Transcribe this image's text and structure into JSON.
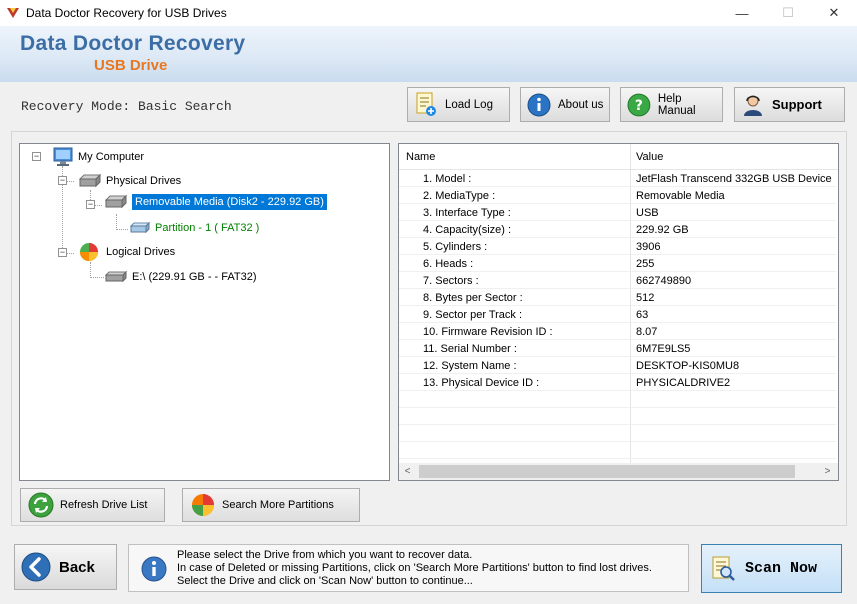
{
  "window": {
    "title": "Data Doctor Recovery for USB Drives",
    "minimize": "—",
    "maximize": "☐",
    "close": "✕"
  },
  "banner": {
    "title": "Data Doctor Recovery",
    "subtitle": "USB Drive"
  },
  "toolbar": {
    "mode_text": "Recovery Mode: Basic Search",
    "load_log": "Load Log",
    "about_us": "About us",
    "help_manual": "Help Manual",
    "support": "Support"
  },
  "tree": {
    "root": "My Computer",
    "physical_drives": "Physical Drives",
    "removable_media": "Removable Media (Disk2 - 229.92 GB)",
    "partition": "Partition - 1 ( FAT32 )",
    "logical_drives": "Logical Drives",
    "logical_e": "E:\\ (229.91 GB -  - FAT32)"
  },
  "props": {
    "col_name": "Name",
    "col_value": "Value",
    "rows": [
      {
        "name": "1. Model :",
        "value": "JetFlash Transcend 332GB USB Device"
      },
      {
        "name": "2. MediaType :",
        "value": "Removable Media"
      },
      {
        "name": "3. Interface Type :",
        "value": "USB"
      },
      {
        "name": "4. Capacity(size) :",
        "value": "229.92 GB"
      },
      {
        "name": "5. Cylinders :",
        "value": "3906"
      },
      {
        "name": "6. Heads :",
        "value": "255"
      },
      {
        "name": "7. Sectors :",
        "value": "662749890"
      },
      {
        "name": "8. Bytes per Sector :",
        "value": "512"
      },
      {
        "name": "9. Sector per Track :",
        "value": "63"
      },
      {
        "name": "10. Firmware Revision ID :",
        "value": "8.07"
      },
      {
        "name": "11. Serial Number :",
        "value": "6M7E9LS5"
      },
      {
        "name": "12. System Name :",
        "value": "DESKTOP-KIS0MU8"
      },
      {
        "name": "13. Physical Device ID :",
        "value": "PHYSICALDRIVE2"
      }
    ],
    "scroll_left": "<",
    "scroll_right": ">"
  },
  "actions": {
    "refresh": "Refresh Drive List",
    "search_more": "Search More Partitions"
  },
  "footer": {
    "back": "Back",
    "info_line1": "Please select the Drive from which you want to recover data.",
    "info_line2": "In case of Deleted or missing Partitions, click on 'Search More Partitions' button to find lost drives.",
    "info_line3": "Select the Drive and click on 'Scan Now' button to continue...",
    "scan_now": "Scan Now"
  },
  "colors": {
    "banner_title": "#3c6ea5",
    "banner_sub": "#e87722",
    "selection": "#0078d7",
    "partition": "#008000"
  }
}
